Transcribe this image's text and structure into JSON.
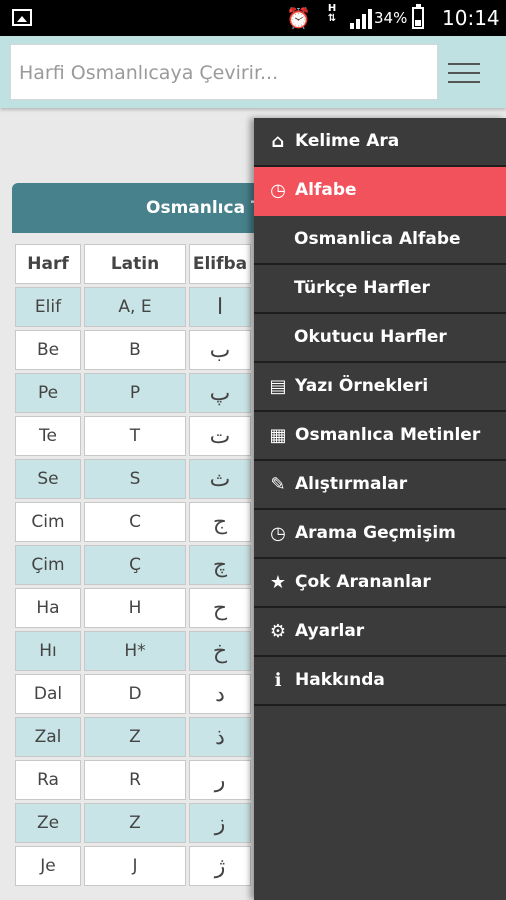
{
  "status_bar": {
    "time": "10:14",
    "battery_percent": "34%",
    "network_type": "H",
    "icons": [
      "gallery-icon",
      "alarm-icon",
      "signal-icon",
      "battery-icon"
    ]
  },
  "search": {
    "placeholder": "Harfi Osmanlıcaya Çevirir..."
  },
  "section": {
    "title": "Osmanlıca T"
  },
  "table": {
    "headers": [
      "Harf",
      "Latin",
      "Elifba"
    ],
    "rows": [
      {
        "harf": "Elif",
        "latin": "A, E",
        "elifba": "ا"
      },
      {
        "harf": "Be",
        "latin": "B",
        "elifba": "ب"
      },
      {
        "harf": "Pe",
        "latin": "P",
        "elifba": "پ"
      },
      {
        "harf": "Te",
        "latin": "T",
        "elifba": "ت"
      },
      {
        "harf": "Se",
        "latin": "S",
        "elifba": "ث"
      },
      {
        "harf": "Cim",
        "latin": "C",
        "elifba": "ج"
      },
      {
        "harf": "Çim",
        "latin": "Ç",
        "elifba": "چ"
      },
      {
        "harf": "Ha",
        "latin": "H",
        "elifba": "ح"
      },
      {
        "harf": "Hı",
        "latin": "H*",
        "elifba": "خ"
      },
      {
        "harf": "Dal",
        "latin": "D",
        "elifba": "د"
      },
      {
        "harf": "Zal",
        "latin": "Z",
        "elifba": "ذ"
      },
      {
        "harf": "Ra",
        "latin": "R",
        "elifba": "ر"
      },
      {
        "harf": "Ze",
        "latin": "Z",
        "elifba": "ز"
      },
      {
        "harf": "Je",
        "latin": "J",
        "elifba": "ژ"
      }
    ]
  },
  "drawer": {
    "active_color": "#f2525c",
    "items": [
      {
        "label": "Kelime Ara",
        "icon": "home-icon",
        "glyph": "⌂"
      },
      {
        "label": "Alfabe",
        "icon": "clock-icon",
        "glyph": "◷"
      },
      {
        "label": "Osmanlica Alfabe",
        "icon": "",
        "glyph": ""
      },
      {
        "label": "Türkçe Harfler",
        "icon": "",
        "glyph": ""
      },
      {
        "label": "Okutucu Harfler",
        "icon": "",
        "glyph": ""
      },
      {
        "label": "Yazı Örnekleri",
        "icon": "note-icon",
        "glyph": "▤"
      },
      {
        "label": "Osmanlıca Metinler",
        "icon": "document-icon",
        "glyph": "▦"
      },
      {
        "label": "Alıştırmalar",
        "icon": "edit-icon",
        "glyph": "✎"
      },
      {
        "label": "Arama Geçmişim",
        "icon": "history-icon",
        "glyph": "◷"
      },
      {
        "label": "Çok Arananlar",
        "icon": "star-icon",
        "glyph": "★"
      },
      {
        "label": "Ayarlar",
        "icon": "gear-icon",
        "glyph": "⚙"
      },
      {
        "label": "Hakkında",
        "icon": "info-icon",
        "glyph": "ℹ"
      }
    ]
  }
}
